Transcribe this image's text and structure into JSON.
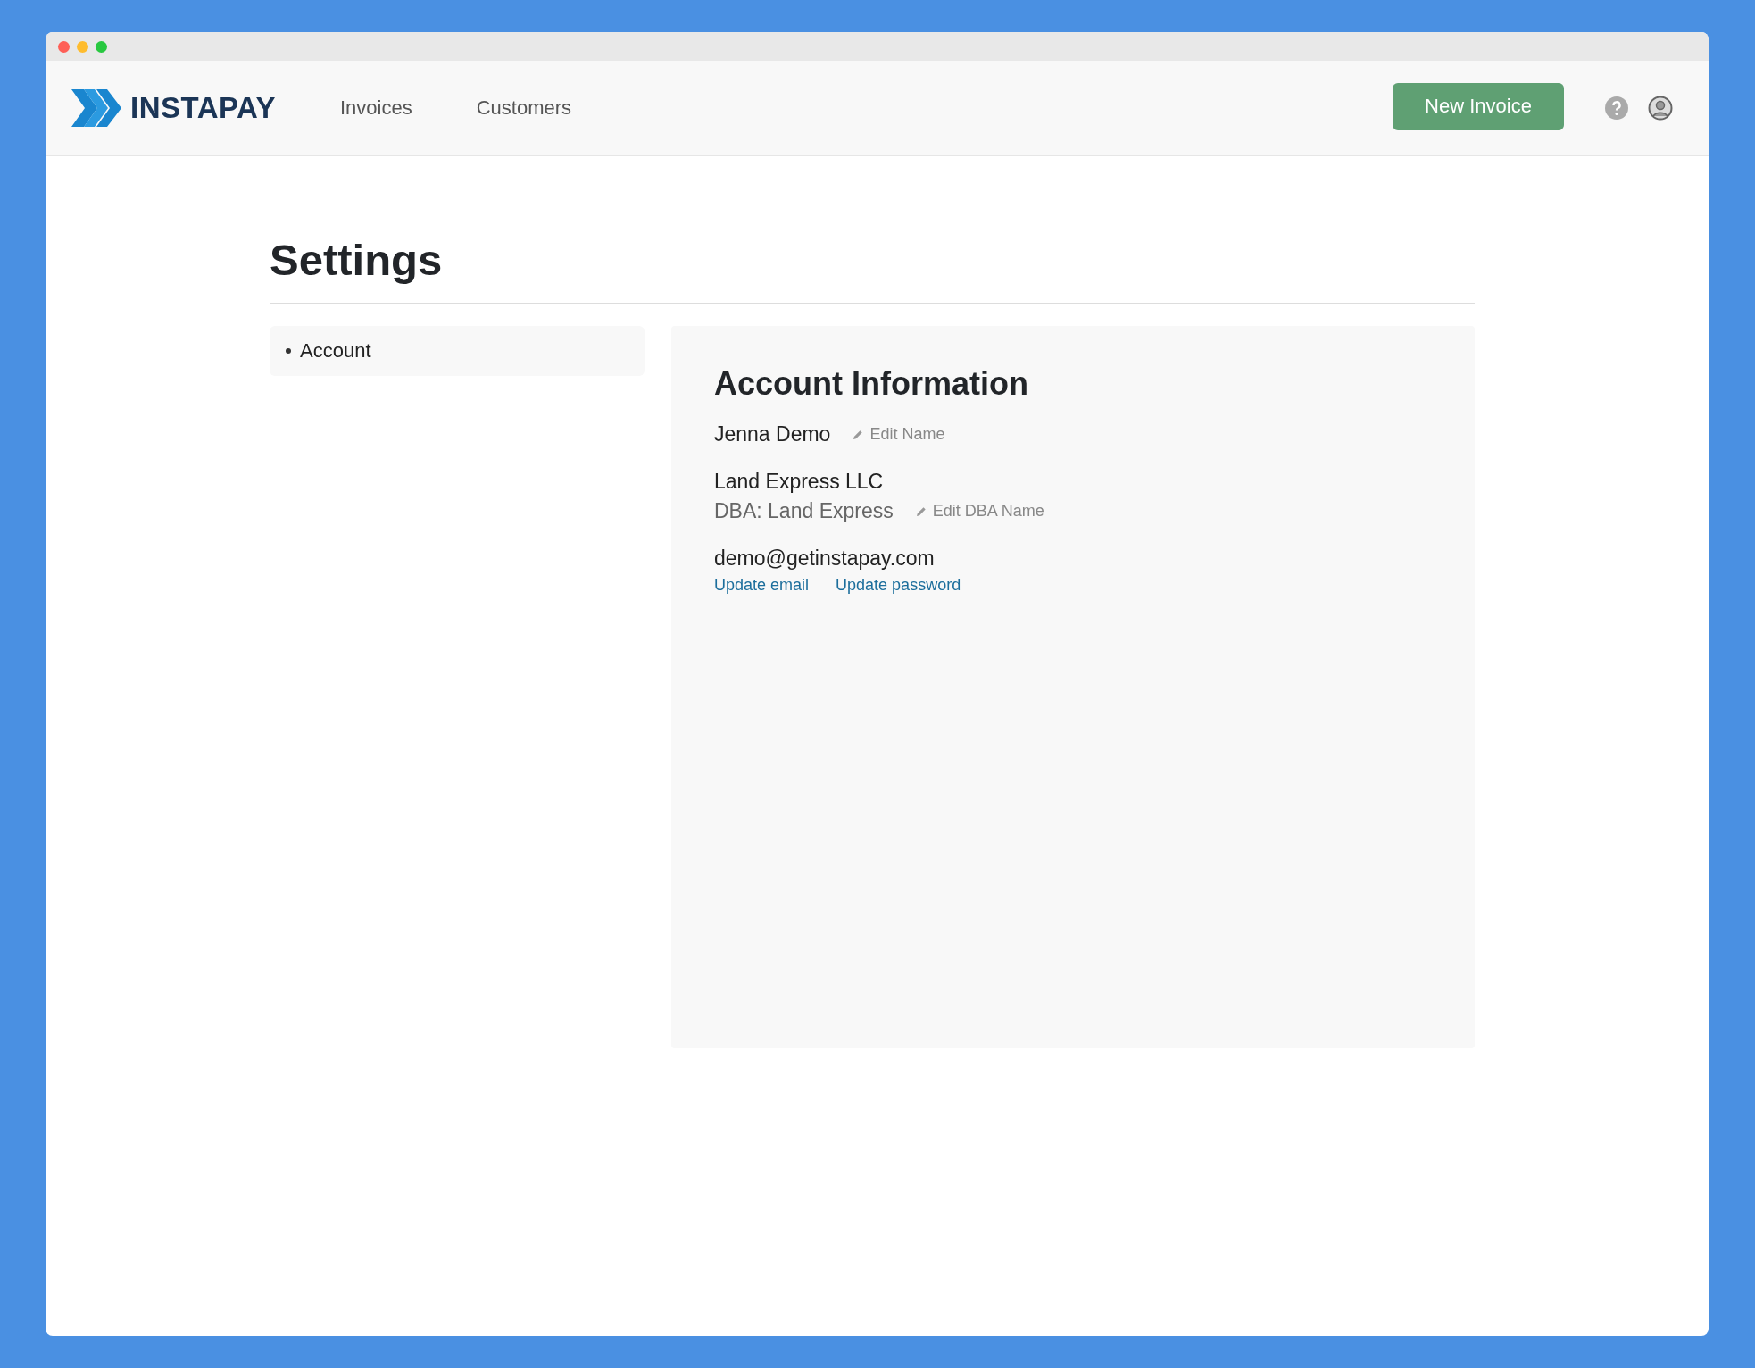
{
  "header": {
    "brand": "INSTAPAY",
    "nav": [
      "Invoices",
      "Customers"
    ],
    "new_button": "New Invoice"
  },
  "page": {
    "title": "Settings"
  },
  "sidebar": {
    "items": [
      {
        "label": "Account"
      }
    ]
  },
  "account": {
    "heading": "Account Information",
    "name": "Jenna Demo",
    "edit_name": "Edit Name",
    "company": "Land Express LLC",
    "dba": "DBA: Land Express",
    "edit_dba": "Edit DBA Name",
    "email": "demo@getinstapay.com",
    "links": [
      "Update email",
      "Update password"
    ]
  }
}
